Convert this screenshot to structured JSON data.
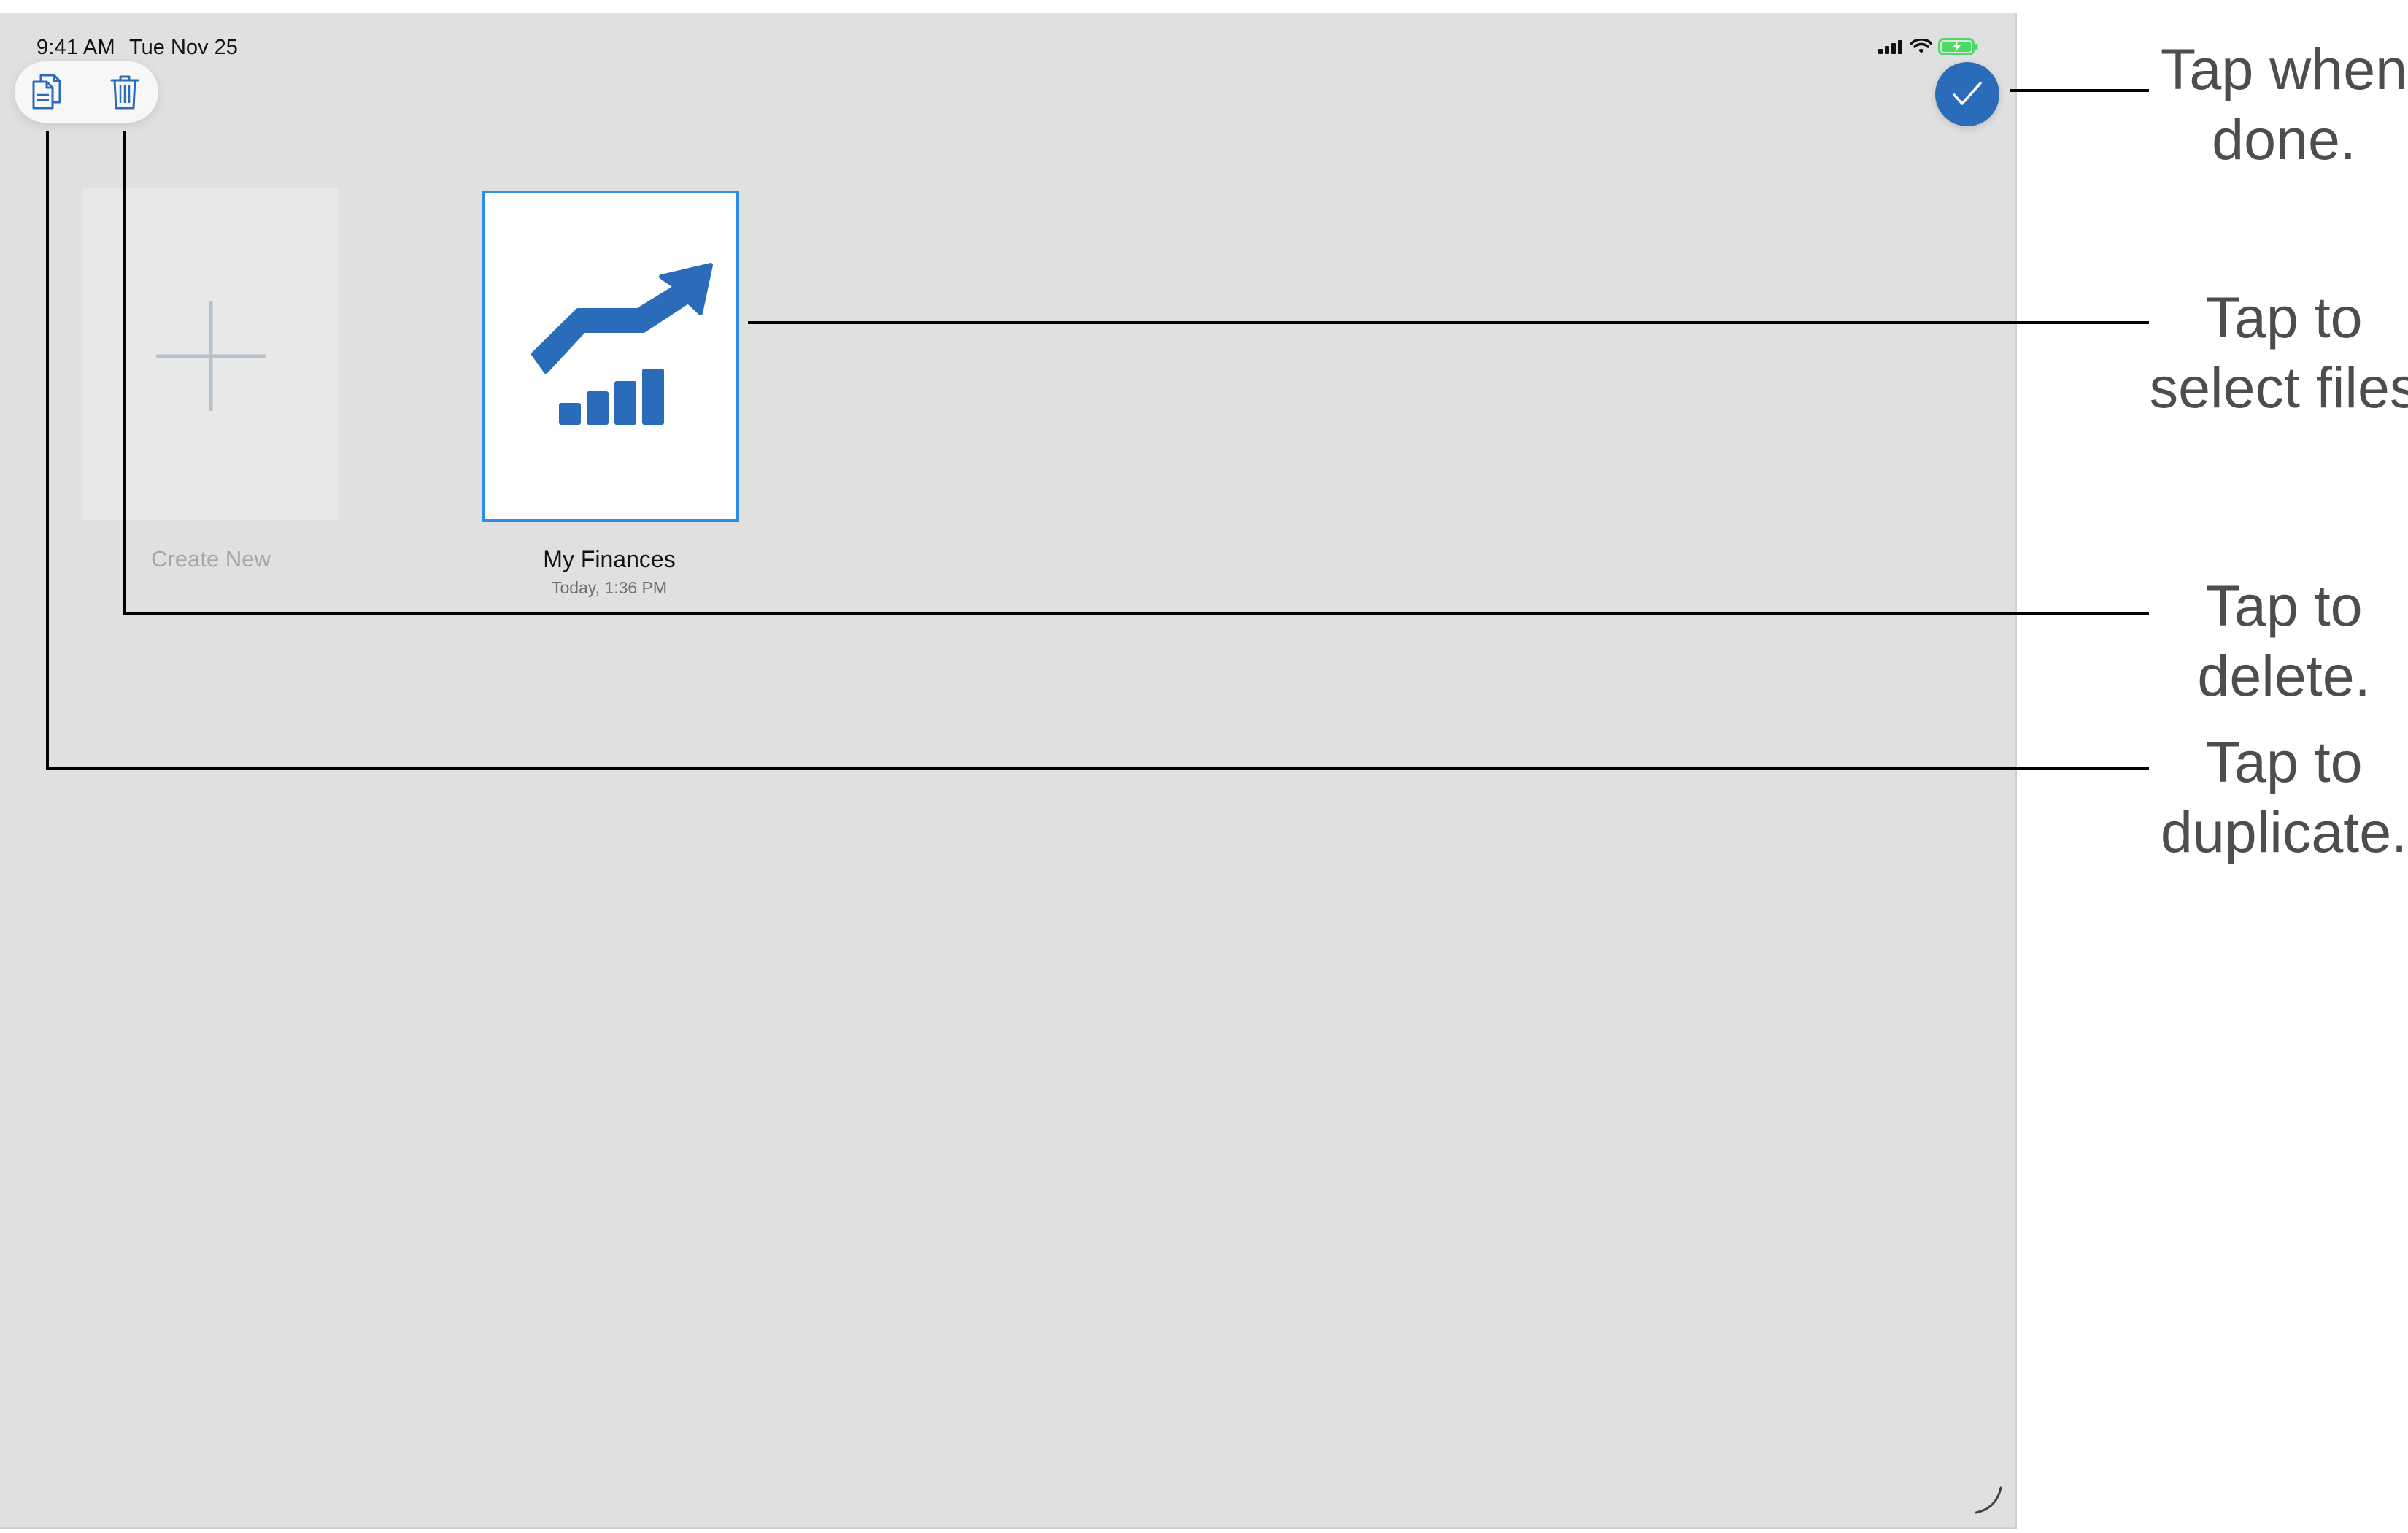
{
  "status_bar": {
    "time": "9:41 AM",
    "date": "Tue Nov 25"
  },
  "toolbar": {
    "duplicate_icon": "duplicate-icon",
    "delete_icon": "trash-icon",
    "done_icon": "checkmark-icon"
  },
  "tiles": {
    "create_new_label": "Create New",
    "file_name": "My Finances",
    "file_date": "Today, 1:36 PM"
  },
  "callouts": {
    "done": "Tap when done.",
    "select": "Tap to select files",
    "delete": "Tap to delete.",
    "duplicate": "Tap to duplicate."
  },
  "colors": {
    "accent": "#2a6cba",
    "selection_border": "#2b8fe8",
    "screen_bg": "#e0e0e0",
    "battery": "#4cd964"
  }
}
